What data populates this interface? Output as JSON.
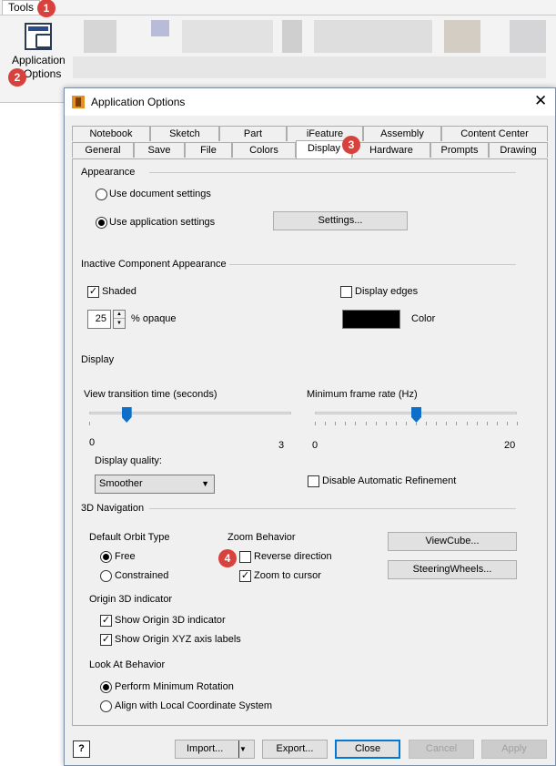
{
  "ribbon": {
    "tab_label": "Tools",
    "app_options_label_line1": "Application",
    "app_options_label_line2": "Options"
  },
  "badges": [
    "1",
    "2",
    "3",
    "4"
  ],
  "dialog": {
    "title": "Application Options",
    "tabs_row1": [
      "Notebook",
      "Sketch",
      "Part",
      "iFeature",
      "Assembly",
      "Content Center"
    ],
    "tabs_row2": [
      "General",
      "Save",
      "File",
      "Colors",
      "Display",
      "Hardware",
      "Prompts",
      "Drawing"
    ],
    "active_tab": "Display",
    "appearance": {
      "heading": "Appearance",
      "use_document": "Use document settings",
      "use_application": "Use application settings",
      "settings_button": "Settings..."
    },
    "inactive": {
      "heading": "Inactive Component Appearance",
      "shaded": "Shaded",
      "display_edges": "Display edges",
      "opaque_value": "25",
      "opaque_label": "% opaque",
      "color_label": "Color",
      "color_value": "#000000"
    },
    "display": {
      "heading": "Display",
      "view_transition_label": "View transition time (seconds)",
      "view_transition_min": "0",
      "view_transition_max": "3",
      "view_transition_value": 0.55,
      "min_frame_label": "Minimum frame rate (Hz)",
      "min_frame_min": "0",
      "min_frame_max": "20",
      "min_frame_value": 10,
      "quality_label": "Display quality:",
      "quality_value": "Smoother",
      "disable_refinement": "Disable Automatic Refinement"
    },
    "nav3d": {
      "heading": "3D Navigation",
      "orbit_heading": "Default Orbit Type",
      "orbit_free": "Free",
      "orbit_constrained": "Constrained",
      "zoom_heading": "Zoom Behavior",
      "reverse_direction": "Reverse direction",
      "zoom_to_cursor": "Zoom to cursor",
      "viewcube_button": "ViewCube...",
      "steering_button": "SteeringWheels...",
      "origin_heading": "Origin 3D indicator",
      "show_origin": "Show Origin 3D indicator",
      "show_xyz": "Show Origin XYZ axis labels",
      "lookat_heading": "Look At Behavior",
      "perform_min": "Perform Minimum Rotation",
      "align_local": "Align with Local Coordinate System"
    },
    "footer": {
      "help": "?",
      "import": "Import...",
      "export": "Export...",
      "close": "Close",
      "cancel": "Cancel",
      "apply": "Apply"
    }
  }
}
